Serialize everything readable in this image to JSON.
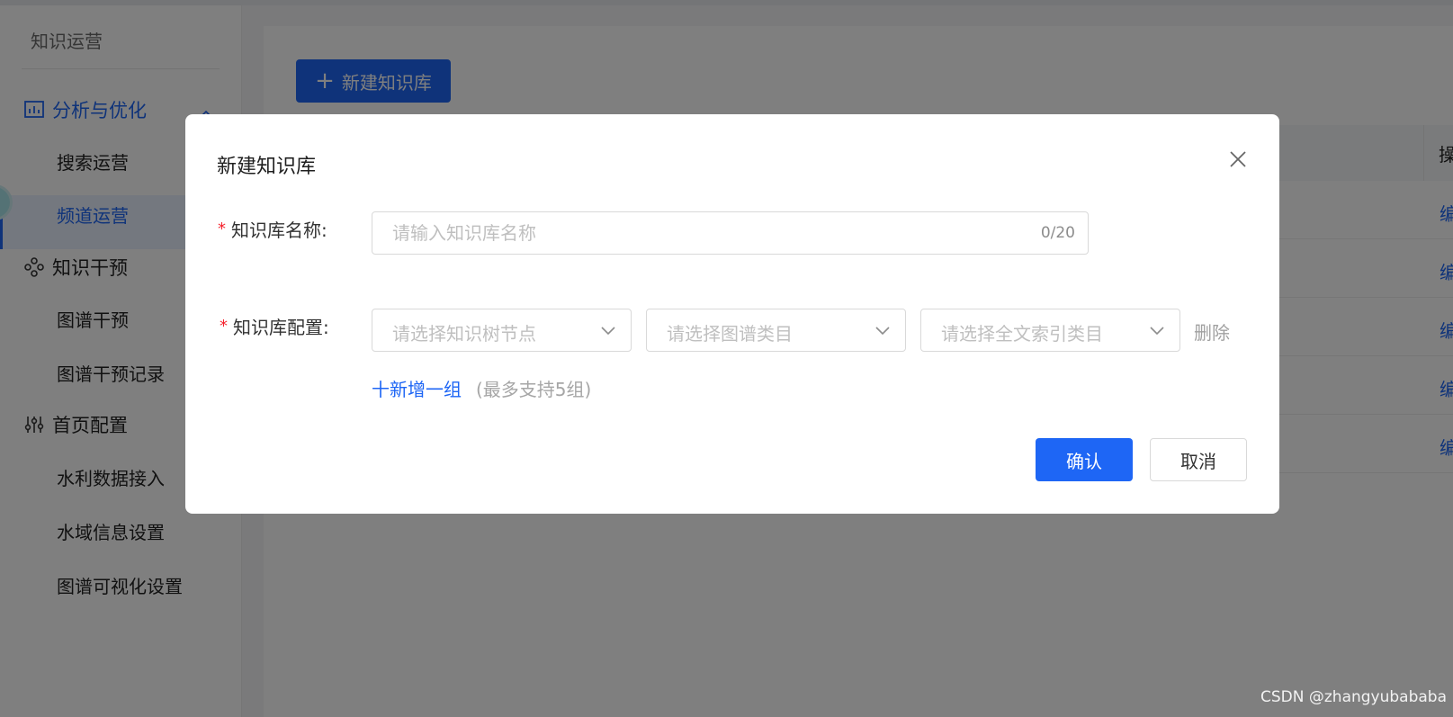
{
  "sidebar": {
    "title": "知识运营",
    "groups": [
      {
        "label": "分析与优化",
        "icon": "chart-icon",
        "items": [
          "搜索运营",
          "频道运营"
        ]
      },
      {
        "label": "知识干预",
        "icon": "nodes-icon",
        "items": [
          "图谱干预",
          "图谱干预记录"
        ]
      },
      {
        "label": "首页配置",
        "icon": "sliders-icon",
        "items": [
          "水利数据接入",
          "水域信息设置",
          "图谱可视化设置"
        ]
      }
    ],
    "selected_item": "频道运营"
  },
  "main": {
    "new_button_label": "新建知识库",
    "table_op_header": "操",
    "row_action_label": "编"
  },
  "dialog": {
    "title": "新建知识库",
    "name_label": "知识库名称:",
    "name_placeholder": "请输入知识库名称",
    "name_value": "",
    "name_counter": "0/20",
    "config_label": "知识库配置:",
    "select_tree_placeholder": "请选择知识树节点",
    "select_graph_placeholder": "请选择图谱类目",
    "select_fulltext_placeholder": "请选择全文索引类目",
    "delete_label": "删除",
    "add_group_label": "十新增一组",
    "add_group_hint": "(最多支持5组)",
    "confirm_label": "确认",
    "cancel_label": "取消"
  },
  "watermark": "CSDN @zhangyubababa",
  "colors": {
    "primary": "#1e66f5",
    "required": "#f5222d",
    "mask": "rgba(0,0,0,0.5)"
  }
}
